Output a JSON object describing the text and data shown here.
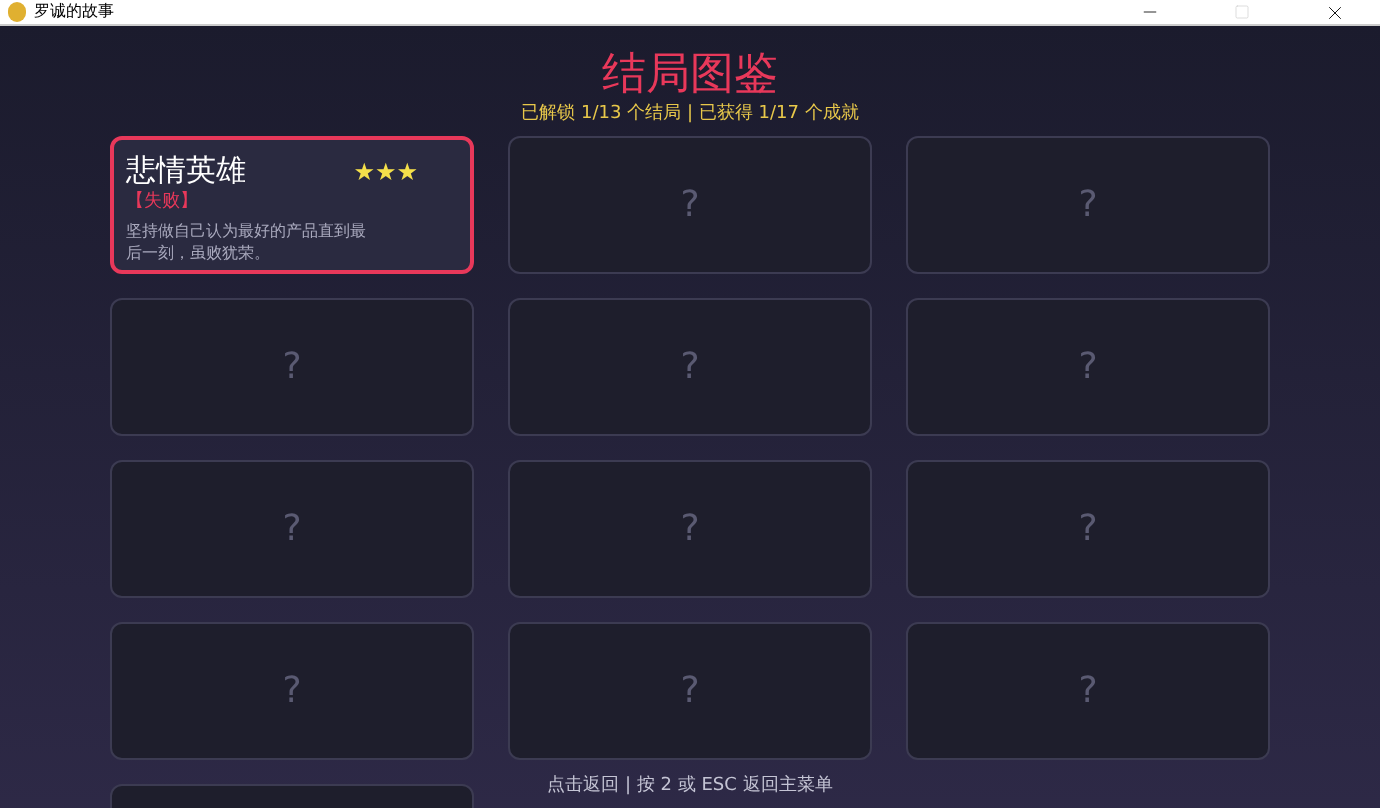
{
  "window": {
    "title": "罗诚的故事",
    "maximize_disabled": true
  },
  "title": "结局图鉴",
  "summary": "已解锁 1/13 个结局 | 已获得 1/17 个成就",
  "endings": [
    {
      "kind": "unlocked",
      "name": "悲情英雄",
      "stars": 3,
      "tag": "【失败】",
      "description": "坚持做自己认为最好的产品直到最后一刻，虽败犹荣。"
    },
    {
      "kind": "locked",
      "mark": "?"
    },
    {
      "kind": "locked",
      "mark": "?"
    },
    {
      "kind": "locked",
      "mark": "?"
    },
    {
      "kind": "locked",
      "mark": "?"
    },
    {
      "kind": "locked",
      "mark": "?"
    },
    {
      "kind": "locked",
      "mark": "?"
    },
    {
      "kind": "locked",
      "mark": "?"
    },
    {
      "kind": "locked",
      "mark": "?"
    },
    {
      "kind": "locked",
      "mark": "?"
    },
    {
      "kind": "locked",
      "mark": "?"
    },
    {
      "kind": "locked",
      "mark": "?"
    },
    {
      "kind": "locked"
    }
  ],
  "footer": "点击返回 | 按 2 或 ESC 返回主菜单"
}
